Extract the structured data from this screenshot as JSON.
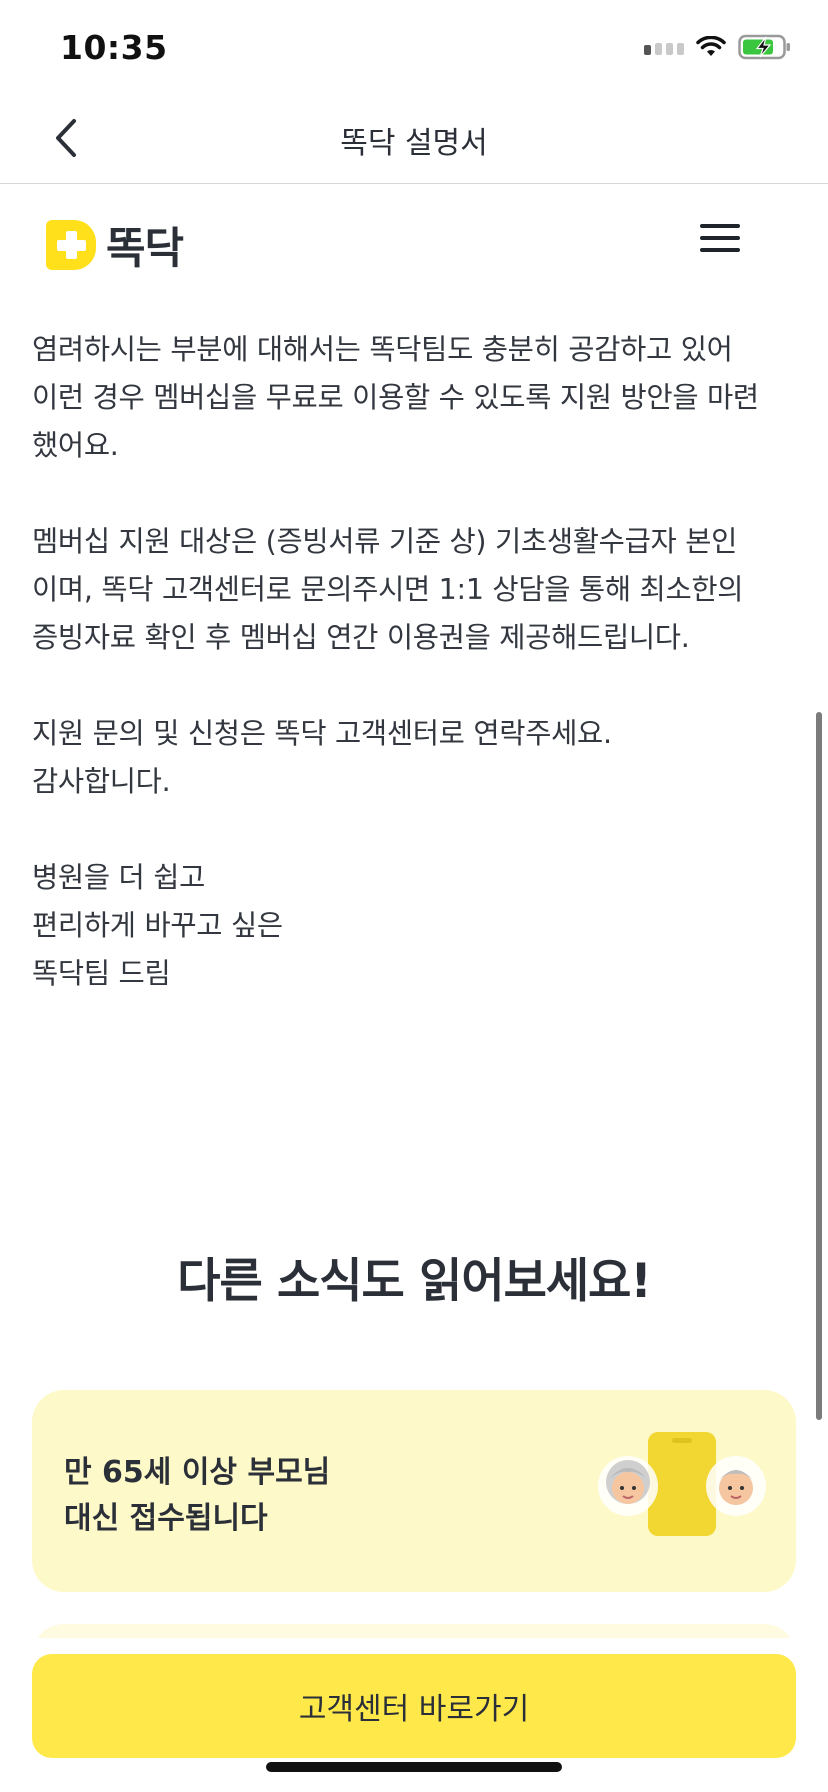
{
  "status_bar": {
    "time": "10:35",
    "icons": [
      "signal-icon",
      "wifi-icon",
      "battery-charging-icon"
    ]
  },
  "nav": {
    "title": "똑닥 설명서",
    "back_icon": "chevron-left-icon"
  },
  "header": {
    "logo_text": "똑닥",
    "brand_color": "#FFE01B",
    "menu_icon": "hamburger-menu-icon"
  },
  "article": {
    "paragraphs": [
      {
        "lines": [
          "염려하시는 부분에 대해서는 똑닥팀도 충분히 공감하고 있어",
          "이런 경우 멤버십을 무료로 이용할 수 있도록 지원 방안을 마련",
          "했어요."
        ]
      },
      {
        "lines": [
          "멤버십 지원 대상은 (증빙서류 기준 상) 기초생활수급자 본인",
          "이며, 똑닥 고객센터로 문의주시면 1:1 상담을 통해 최소한의",
          "증빙자료 확인 후 멤버십 연간 이용권을 제공해드립니다."
        ]
      },
      {
        "lines": [
          "지원 문의 및 신청은 똑닥 고객센터로 연락주세요.",
          "감사합니다."
        ]
      },
      {
        "lines": [
          "병원을 더 쉽고",
          "편리하게 바꾸고 싶은",
          "똑닥팀 드림"
        ]
      }
    ]
  },
  "more_news": {
    "heading": "다른 소식도 읽어보세요!",
    "cards": [
      {
        "title_lines": [
          "만 65세 이상 부모님",
          "대신 접수됩니다"
        ],
        "illustration": "phone-with-grandparents-icon",
        "bg_color": "#FEF9C9"
      }
    ]
  },
  "cta": {
    "label": "고객센터 바로가기",
    "color": "#FFE94A"
  }
}
